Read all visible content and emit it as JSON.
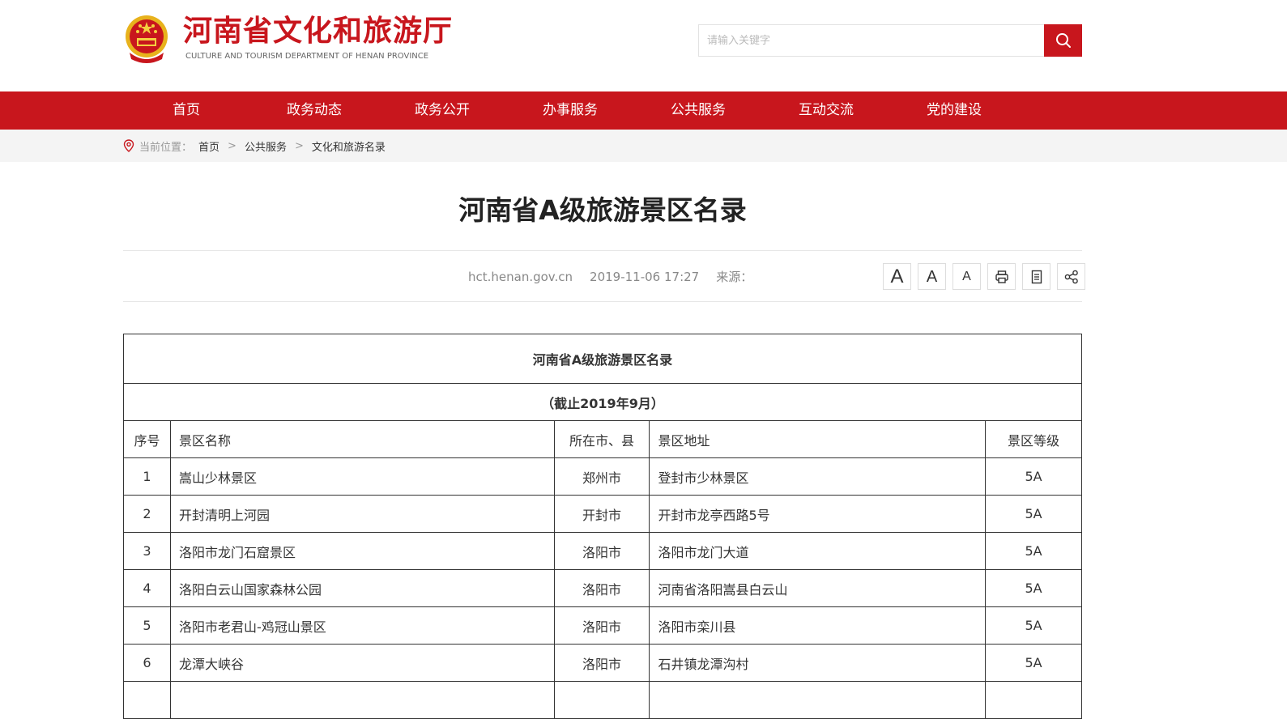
{
  "header": {
    "site_title": "河南省文化和旅游厅",
    "site_subtitle": "CULTURE AND TOURISM DEPARTMENT OF HENAN PROVINCE",
    "search_placeholder": "请输入关键字",
    "brand_color": "#c8161d"
  },
  "nav": {
    "items": [
      "首页",
      "政务动态",
      "政务公开",
      "办事服务",
      "公共服务",
      "互动交流",
      "党的建设"
    ]
  },
  "breadcrumb": {
    "label": "当前位置：",
    "items": [
      "首页",
      "公共服务",
      "文化和旅游名录"
    ],
    "separator": ">"
  },
  "article": {
    "title": "河南省A级旅游景区名录",
    "site": "hct.henan.gov.cn",
    "datetime": "2019-11-06 17:27",
    "source_label": "来源：",
    "tools": [
      "font-large-icon",
      "font-medium-icon",
      "font-small-icon",
      "print-icon",
      "document-icon",
      "share-icon"
    ]
  },
  "table": {
    "caption": "河南省A级旅游景区名录",
    "subtitle": "（截止2019年9月）",
    "headers": [
      "序号",
      "景区名称",
      "所在市、县",
      "景区地址",
      "景区等级"
    ],
    "rows": [
      [
        "1",
        "嵩山少林景区",
        "郑州市",
        "登封市少林景区",
        "5A"
      ],
      [
        "2",
        "开封清明上河园",
        "开封市",
        "开封市龙亭西路5号",
        "5A"
      ],
      [
        "3",
        "洛阳市龙门石窟景区",
        "洛阳市",
        "洛阳市龙门大道",
        "5A"
      ],
      [
        "4",
        "洛阳白云山国家森林公园",
        "洛阳市",
        "河南省洛阳嵩县白云山",
        "5A"
      ],
      [
        "5",
        "洛阳市老君山-鸡冠山景区",
        "洛阳市",
        "洛阳市栾川县",
        "5A"
      ],
      [
        "6",
        "龙潭大峡谷",
        "洛阳市",
        "石井镇龙潭沟村",
        "5A"
      ]
    ]
  }
}
